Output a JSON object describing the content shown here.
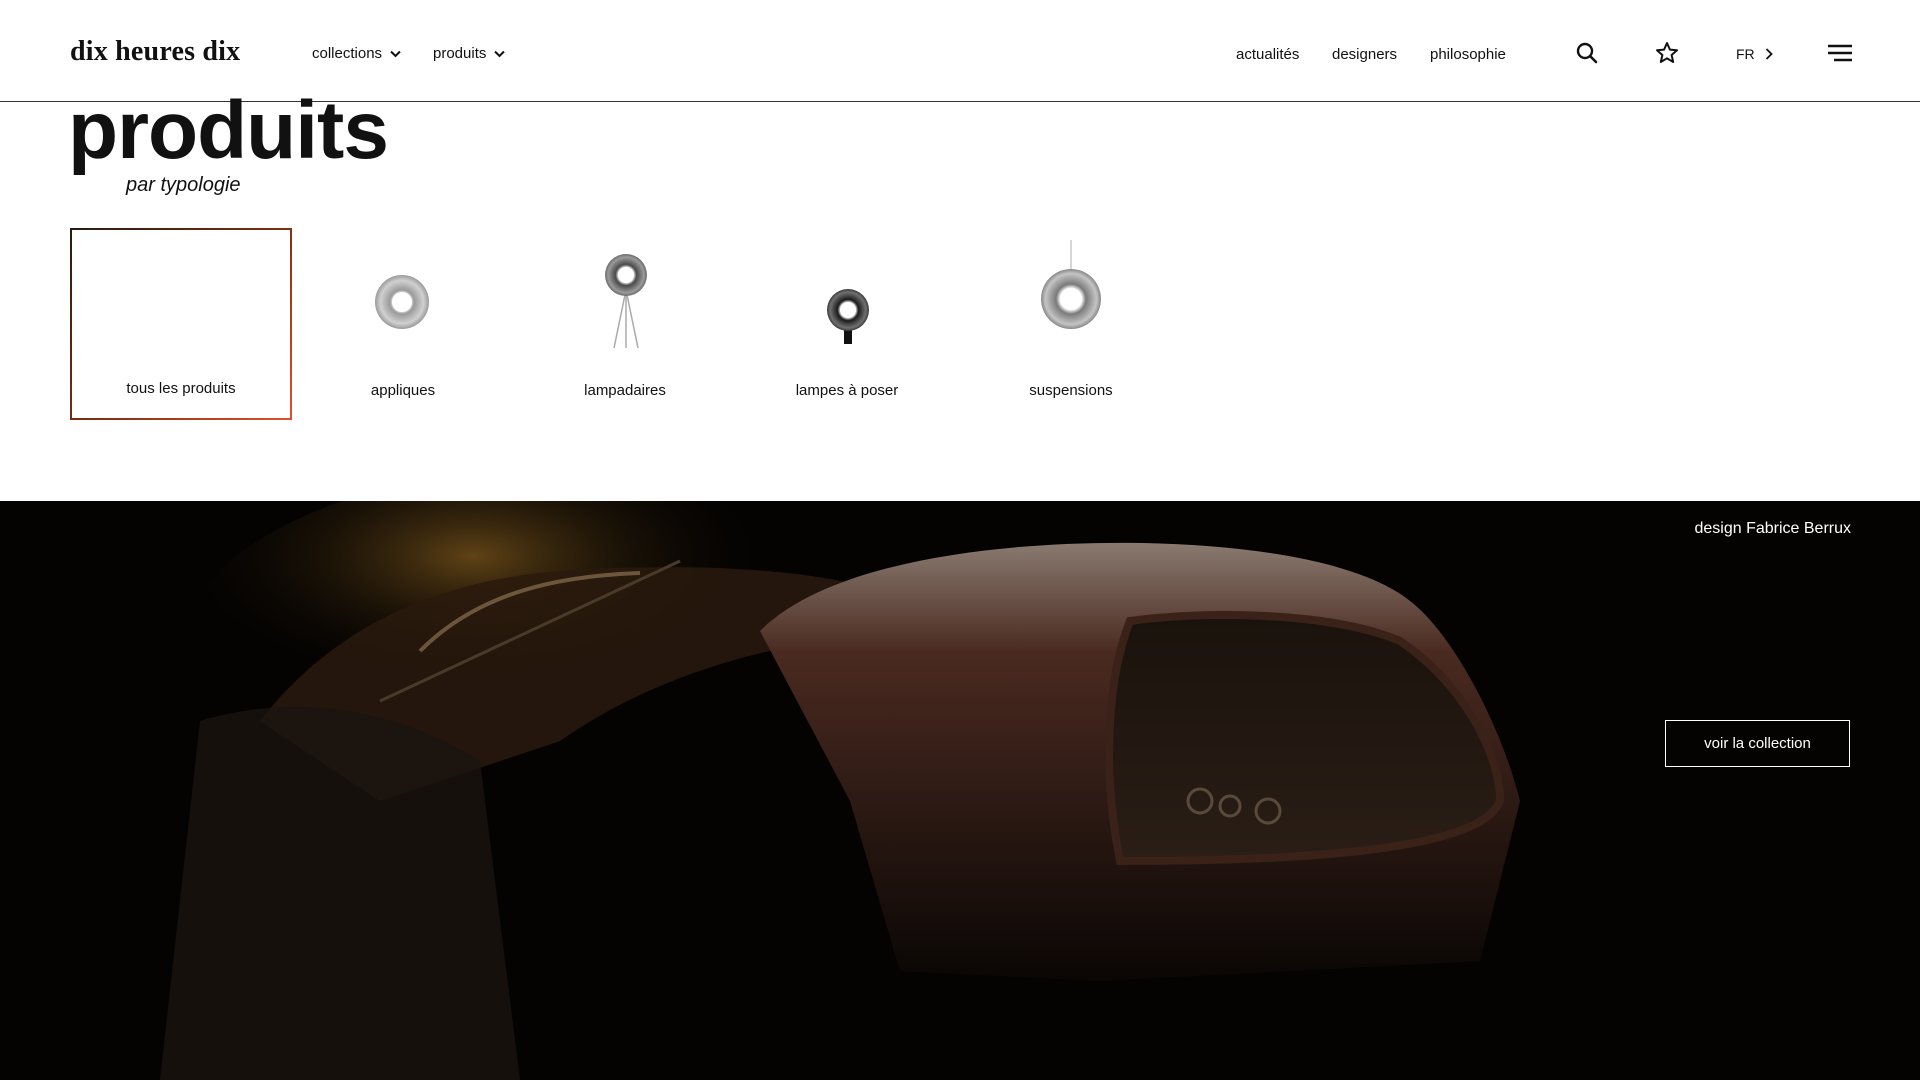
{
  "header": {
    "logo": "dix heures dix",
    "nav_left": [
      {
        "label": "collections"
      },
      {
        "label": "produits"
      }
    ],
    "nav_right": [
      {
        "label": "actualités"
      },
      {
        "label": "designers"
      },
      {
        "label": "philosophie"
      }
    ],
    "language": "FR",
    "icons": [
      "search-icon",
      "star-icon",
      "chevron-right-icon",
      "menu-icon",
      "chevron-down-icon"
    ]
  },
  "page": {
    "title": "produits",
    "subtitle": "par typologie"
  },
  "typologies": [
    {
      "label": "tous les produits",
      "selected": true
    },
    {
      "label": "appliques",
      "selected": false
    },
    {
      "label": "lampadaires",
      "selected": false
    },
    {
      "label": "lampes à poser",
      "selected": false
    },
    {
      "label": "suspensions",
      "selected": false
    }
  ],
  "hero": {
    "credit": "design Fabrice Berrux",
    "cta_label": "voir la collection"
  },
  "colors": {
    "accent": "#e0502a",
    "hero_background": "#050302"
  }
}
